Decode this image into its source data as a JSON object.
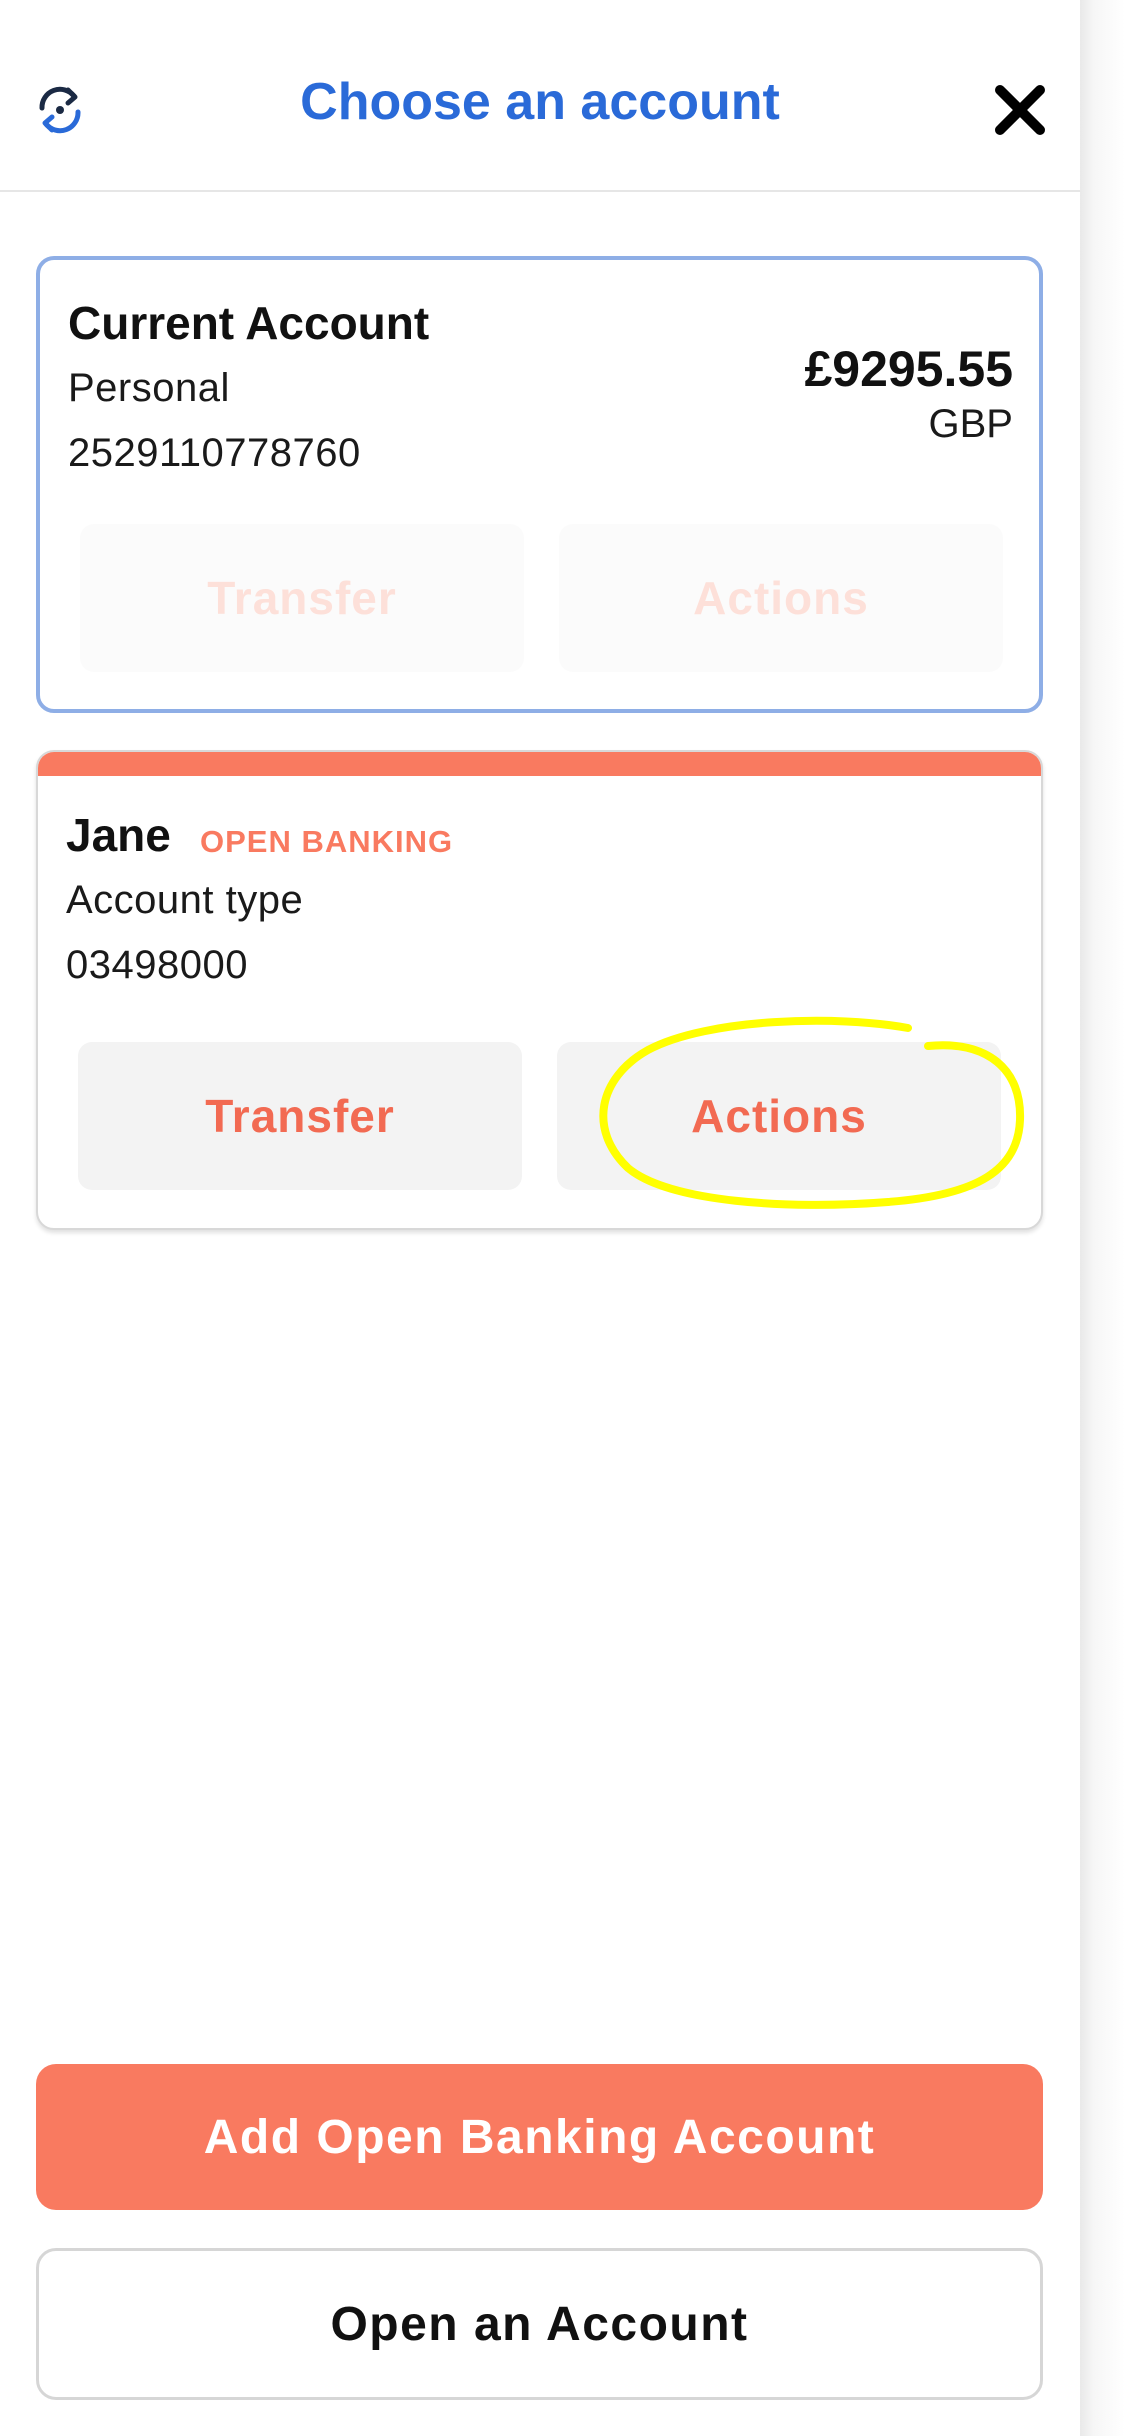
{
  "header": {
    "title": "Choose an account",
    "refresh_icon": "refresh-icon",
    "close_icon": "close-icon"
  },
  "accounts": [
    {
      "name": "Current Account",
      "line1": "Personal",
      "line2": "2529110778760",
      "balance": "£9295.55",
      "currency": "GBP",
      "transfer_label": "Transfer",
      "actions_label": "Actions",
      "selected": true
    },
    {
      "name": "Jane",
      "badge": "OPEN BANKING",
      "line1": "Account type",
      "line2": "03498000",
      "transfer_label": "Transfer",
      "actions_label": "Actions"
    }
  ],
  "footer": {
    "add_label": "Add Open Banking Account",
    "open_label": "Open an Account"
  },
  "colors": {
    "accent": "#f97a60",
    "title_blue": "#2a6ad8",
    "selected_border": "#8eaee6",
    "annotation": "#ffff00"
  }
}
